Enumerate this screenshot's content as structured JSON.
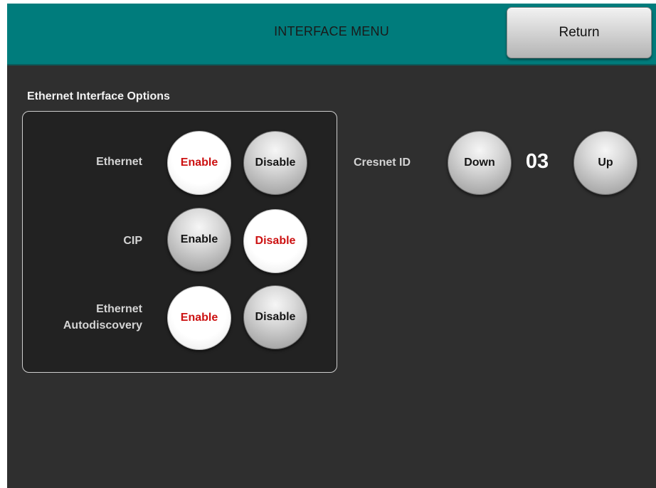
{
  "header": {
    "title": "INTERFACE MENU",
    "return_label": "Return"
  },
  "ethernet_options": {
    "section_title": "Ethernet Interface Options",
    "rows": [
      {
        "label": "Ethernet",
        "enable_label": "Enable",
        "disable_label": "Disable",
        "selected": "Enable"
      },
      {
        "label": "CIP",
        "enable_label": "Enable",
        "disable_label": "Disable",
        "selected": "Disable"
      },
      {
        "label_line1": "Ethernet",
        "label_line2": "Autodiscovery",
        "enable_label": "Enable",
        "disable_label": "Disable",
        "selected": "Enable"
      }
    ]
  },
  "cresnet": {
    "label": "Cresnet ID",
    "down_label": "Down",
    "value": "03",
    "up_label": "Up"
  },
  "colors": {
    "header_bg": "#007c7c",
    "screen_bg": "#2f2f2f",
    "selected_text": "#cc1111"
  }
}
